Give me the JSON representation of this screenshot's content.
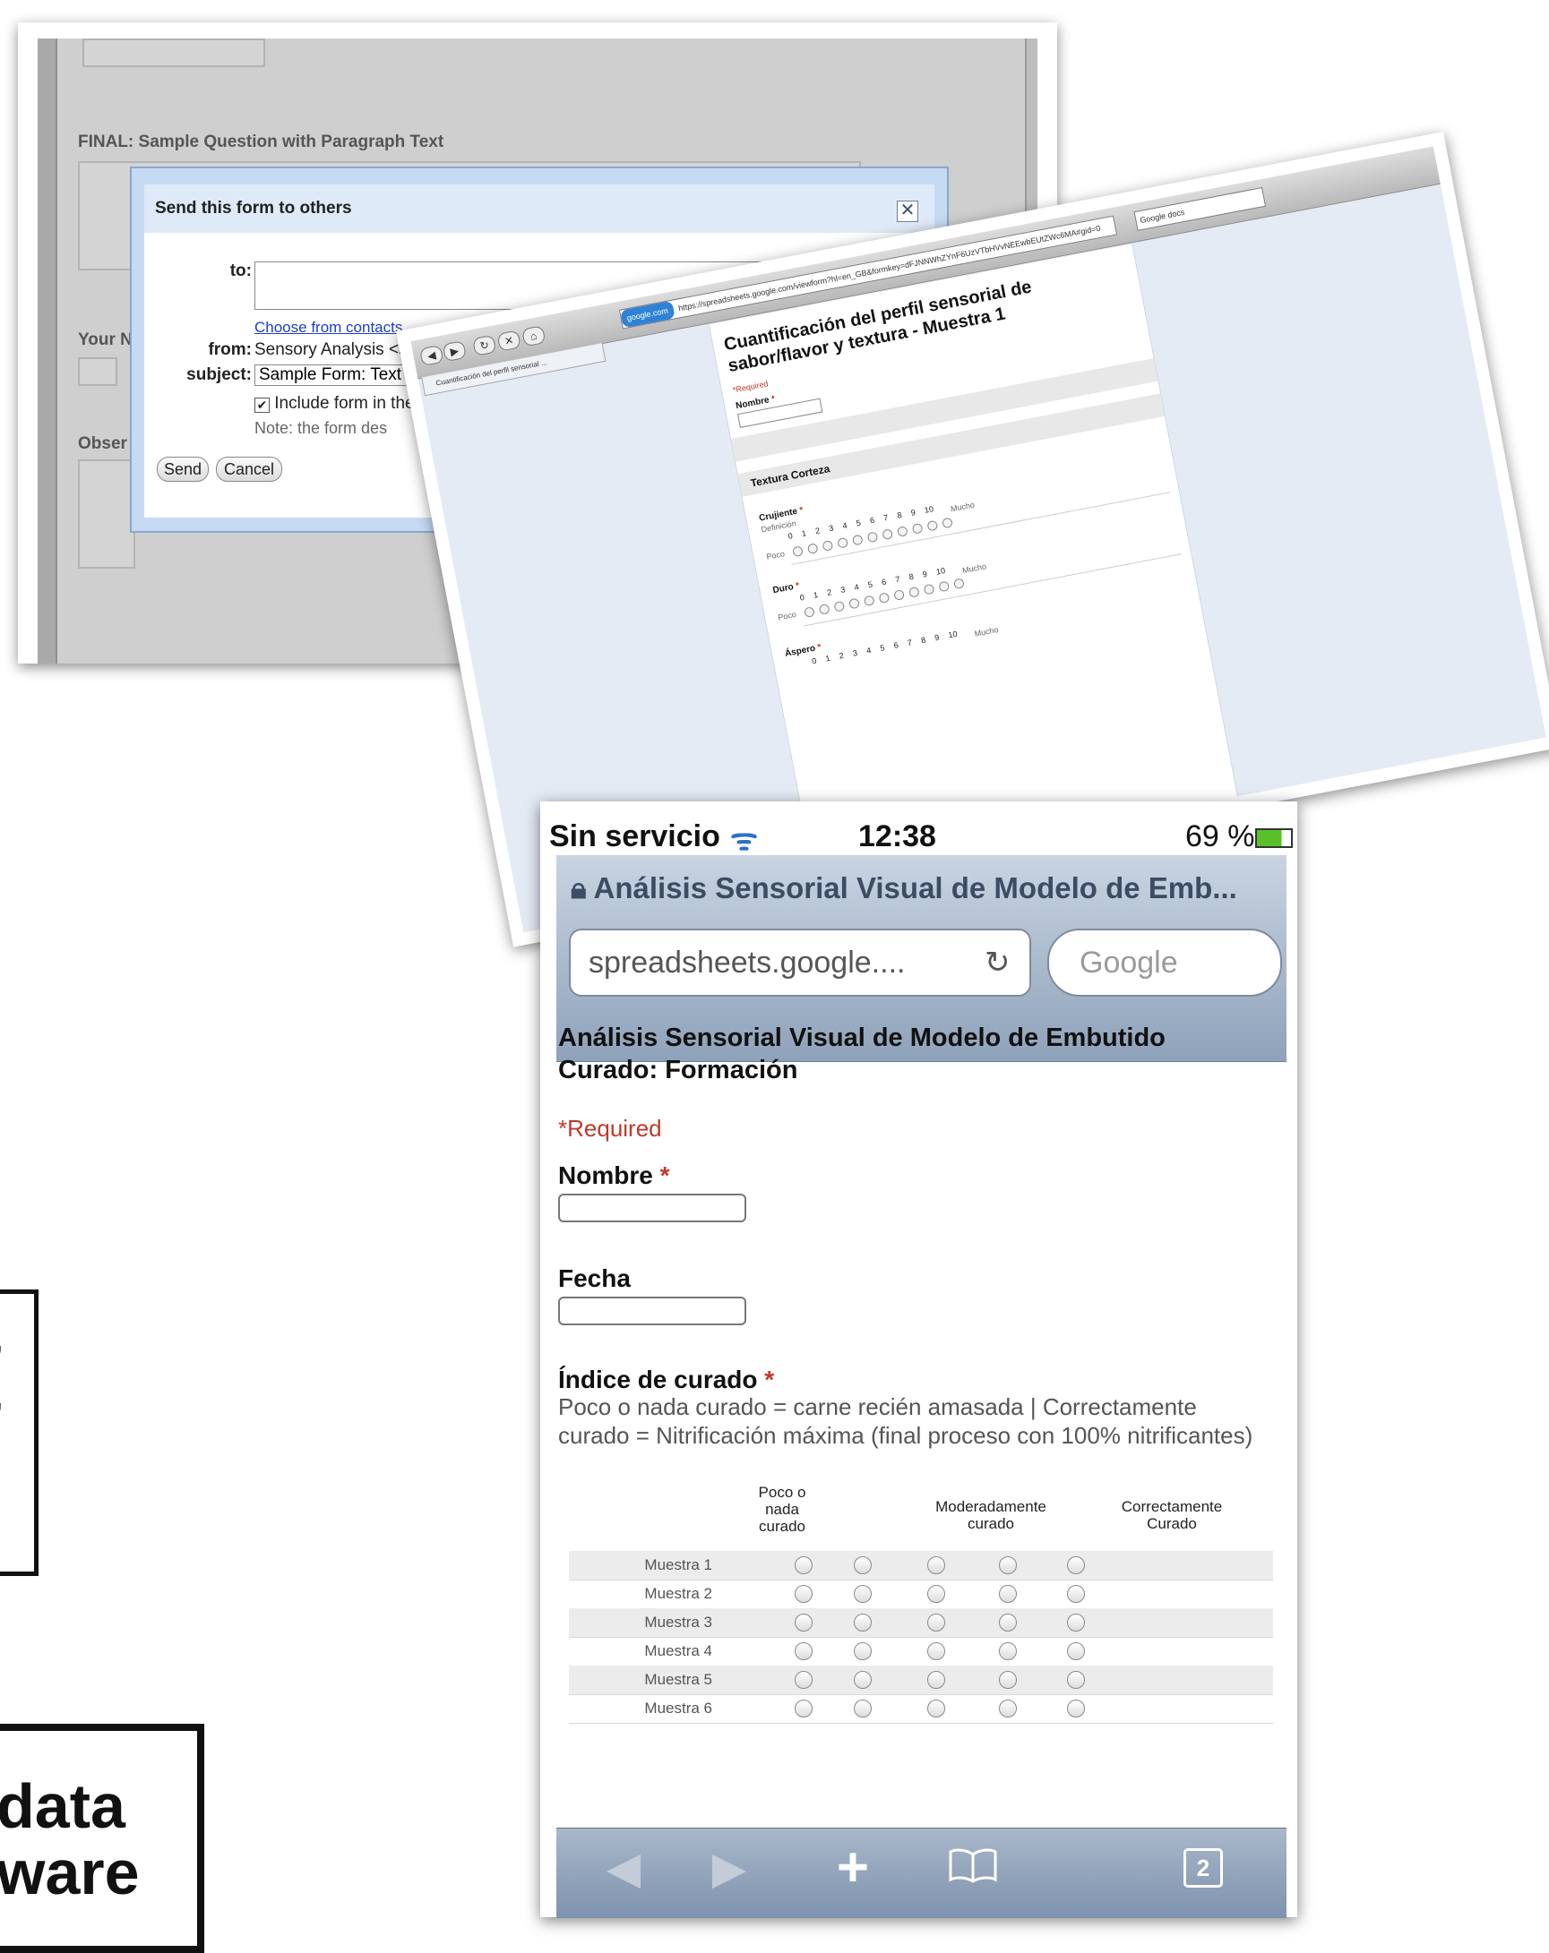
{
  "desktop_dialog": {
    "top_question": "FINAL: Sample Question with Paragraph Text",
    "left_cut_label_1": "Your N",
    "left_cut_label_2": "Obser",
    "title": "Send this form to others",
    "close_glyph": "✕",
    "to_label": "to:",
    "to_value": "",
    "choose_link": "Choose from contacts",
    "from_label": "from:",
    "from_value": "Sensory Analysis <sensory.vitoria@gmail.com>",
    "subject_label": "subject:",
    "subject_value": "Sample Form: Text or Paragraph Text",
    "include_checkbox_checked": true,
    "include_label": "Include form in the email",
    "note": "Note: the form des",
    "send_button": "Send",
    "cancel_button": "Cancel"
  },
  "browser": {
    "url": "https://spreadsheets.google.com/viewform?hl=en_GB&formkey=dFJNNWhZYnF6UzVTbHVvNEEwbEUtZWc6MA#gid=0",
    "site_badge": "google.com",
    "search_value": "Google docs",
    "tab_label": "Cuantificación del perfil sensorial ...",
    "form_title": "Cuantificación del perfil sensorial de sabor/flavor y textura - Muestra 1",
    "required_note": "*Required",
    "name_label": "Nombre",
    "section_title": "Textura Corteza",
    "scale_numbers": "0  1  2  3  4  5  6  7  8  9  10",
    "questions": [
      {
        "label": "Crujiente",
        "sub": "Definición",
        "low": "Poco",
        "high": "Mucho"
      },
      {
        "label": "Duro",
        "sub": "",
        "low": "Poco",
        "high": "Mucho"
      },
      {
        "label": "Áspero",
        "sub": "",
        "low": "",
        "high": "Mucho"
      }
    ]
  },
  "iphone": {
    "carrier": "Sin servicio",
    "time": "12:38",
    "battery": "69 %",
    "page_title": "Análisis Sensorial Visual de Modelo de Emb...",
    "url": "spreadsheets.google....",
    "search_placeholder": "Google",
    "form_title": "Análisis Sensorial Visual de Modelo de Embutido Curado: Formación",
    "required_note": "*Required",
    "field_nombre": "Nombre",
    "field_fecha": "Fecha",
    "field_indice": "Índice de curado",
    "indice_help": "Poco o nada curado = carne recién amasada | Correctamente curado = Nitrificación máxima (final proceso con 100% nitrificantes)",
    "columns": [
      "Poco o nada curado",
      "",
      "Moderadamente curado",
      "",
      "Correctamente Curado"
    ],
    "rows": [
      "Muestra 1",
      "Muestra 2",
      "Muestra 3",
      "Muestra 4",
      "Muestra 5",
      "Muestra 6"
    ],
    "toolbar": {
      "back": "◀",
      "forward": "▶",
      "add": "+",
      "bookmarks": "📖",
      "pages": "2"
    }
  },
  "side_fragments": {
    "box_a_marks": [
      ",",
      ","
    ],
    "box_b_line1": "data",
    "box_b_line2": "ware"
  }
}
